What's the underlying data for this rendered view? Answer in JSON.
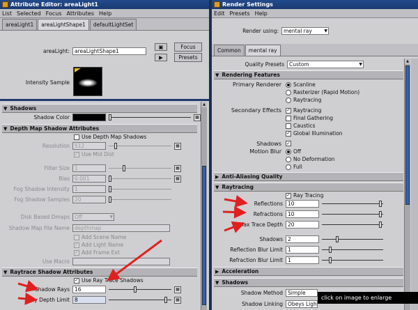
{
  "attribute_editor": {
    "title": "Attribute Editor: areaLight1",
    "menu": [
      "List",
      "Selected",
      "Focus",
      "Attributes",
      "Help"
    ],
    "tabs": [
      "areaLight1",
      "areaLightShape1",
      "defaultLightSet"
    ],
    "active_tab": 1,
    "area_light_label": "areaLight:",
    "area_light_value": "areaLightShape1",
    "focus_button": "Focus",
    "presets_button": "Presets",
    "intensity_sample_label": "Intensity Sample",
    "shadows_section": "Shadows",
    "shadow_color_label": "Shadow Color",
    "depth_map_section": "Depth Map Shadow Attributes",
    "use_depth_map_shadows": "Use Depth Map Shadows",
    "resolution_label": "Resolution",
    "resolution_value": "512",
    "use_mid_dist": "Use Mid Dist",
    "filter_size_label": "Filter Size",
    "filter_size_value": "1",
    "bias_label": "Bias",
    "bias_value": "0.001",
    "fog_intensity_label": "Fog Shadow Intensity",
    "fog_intensity_value": "1",
    "fog_samples_label": "Fog Shadow Samples",
    "fog_samples_value": "20",
    "disk_based_label": "Disk Based Dmaps",
    "disk_based_value": "Off",
    "shadow_map_name_label": "Shadow Map File Name",
    "shadow_map_name_value": "depthmap",
    "add_scene_name": "Add Scene Name",
    "add_light_name": "Add Light Name",
    "add_frame_ext": "Add Frame Ext",
    "use_macro_label": "Use Macro",
    "raytrace_section": "Raytrace Shadow Attributes",
    "use_ray_trace_shadows": "Use Ray Trace Shadows",
    "shadow_rays_label": "Shadow Rays",
    "shadow_rays_value": "16",
    "ray_depth_limit_label": "Ray Depth Limit",
    "ray_depth_limit_value": "8"
  },
  "render_settings": {
    "title": "Render Settings",
    "menu": [
      "Edit",
      "Presets",
      "Help"
    ],
    "render_using_label": "Render using:",
    "render_using_value": "mental ray",
    "tabs": [
      "Common",
      "mental ray"
    ],
    "active_tab": 1,
    "quality_presets_label": "Quality Presets",
    "quality_presets_value": "Custom",
    "rendering_features_section": "Rendering Features",
    "primary_renderer_label": "Primary Renderer",
    "primary_renderer_options": [
      "Scanline",
      "Rasterizer (Rapid Motion)",
      "Raytracing"
    ],
    "secondary_effects_label": "Secondary Effects",
    "secondary_effects_options": [
      "Raytracing",
      "Final Gathering",
      "Caustics",
      "Global Illumination"
    ],
    "shadows_label": "Shadows",
    "motion_blur_label": "Motion Blur",
    "motion_blur_options": [
      "Off",
      "No Deformation",
      "Full"
    ],
    "anti_aliasing_section": "Anti-Aliasing Quality",
    "raytracing_section": "Raytracing",
    "ray_tracing_checkbox": "Ray Tracing",
    "reflections_label": "Reflections",
    "reflections_value": "10",
    "refractions_label": "Refractions",
    "refractions_value": "10",
    "max_trace_depth_label": "Max Trace Depth",
    "max_trace_depth_value": "20",
    "rt_shadows_label": "Shadows",
    "rt_shadows_value": "2",
    "reflection_blur_label": "Reflection Blur Limit",
    "reflection_blur_value": "1",
    "refraction_blur_label": "Refraction Blur Limit",
    "refraction_blur_value": "1",
    "acceleration_section": "Acceleration",
    "shadows_section": "Shadows",
    "shadow_method_label": "Shadow Method",
    "shadow_method_value": "Simple",
    "shadow_linking_label": "Shadow Linking",
    "shadow_linking_value": "Obeys Light Linking"
  },
  "banner": "click on image to enlarge",
  "colors": {
    "annotation_arrow": "#e02020",
    "title_bar": "#234a8c",
    "panel": "#cfcfd2"
  }
}
